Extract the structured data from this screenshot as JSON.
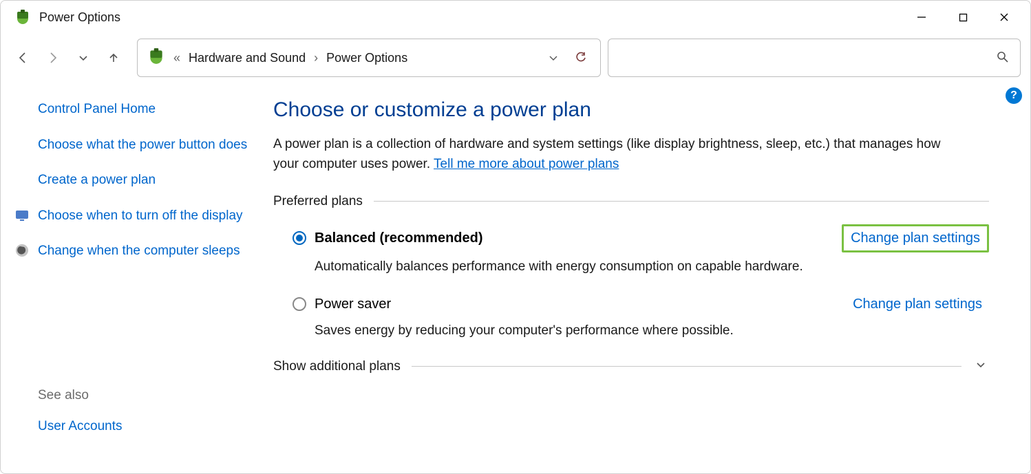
{
  "window": {
    "title": "Power Options"
  },
  "breadcrumb": {
    "ellipsis": "«",
    "items": [
      "Hardware and Sound",
      "Power Options"
    ]
  },
  "sidebar": {
    "home": "Control Panel Home",
    "links": [
      "Choose what the power button does",
      "Create a power plan",
      "Choose when to turn off the display",
      "Change when the computer sleeps"
    ],
    "see_also_label": "See also",
    "see_also_links": [
      "User Accounts"
    ]
  },
  "main": {
    "heading": "Choose or customize a power plan",
    "description_pre": "A power plan is a collection of hardware and system settings (like display brightness, sleep, etc.) that manages how your computer uses power. ",
    "description_link": "Tell me more about power plans",
    "preferred_label": "Preferred plans",
    "additional_label": "Show additional plans",
    "change_link": "Change plan settings",
    "plans": [
      {
        "name": "Balanced (recommended)",
        "desc": "Automatically balances performance with energy consumption on capable hardware.",
        "selected": true,
        "highlight": true
      },
      {
        "name": "Power saver",
        "desc": "Saves energy by reducing your computer's performance where possible.",
        "selected": false,
        "highlight": false
      }
    ]
  },
  "help_badge": "?"
}
